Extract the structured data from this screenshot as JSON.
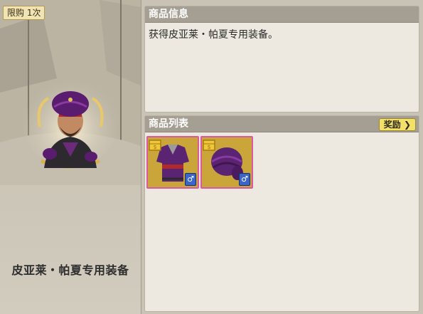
{
  "left": {
    "limit_badge": "限购 1次",
    "item_name": "皮亚莱・帕夏专用装备"
  },
  "info": {
    "header": "商品信息",
    "description": "获得皮亚莱・帕夏专用装备。"
  },
  "list": {
    "header": "商品列表",
    "reward_button": "奖励",
    "reward_arrow": "❯",
    "items": [
      {
        "icon": "purple-robe",
        "gender_symbol": "♂"
      },
      {
        "icon": "purple-turban",
        "gender_symbol": "♂"
      }
    ]
  }
}
